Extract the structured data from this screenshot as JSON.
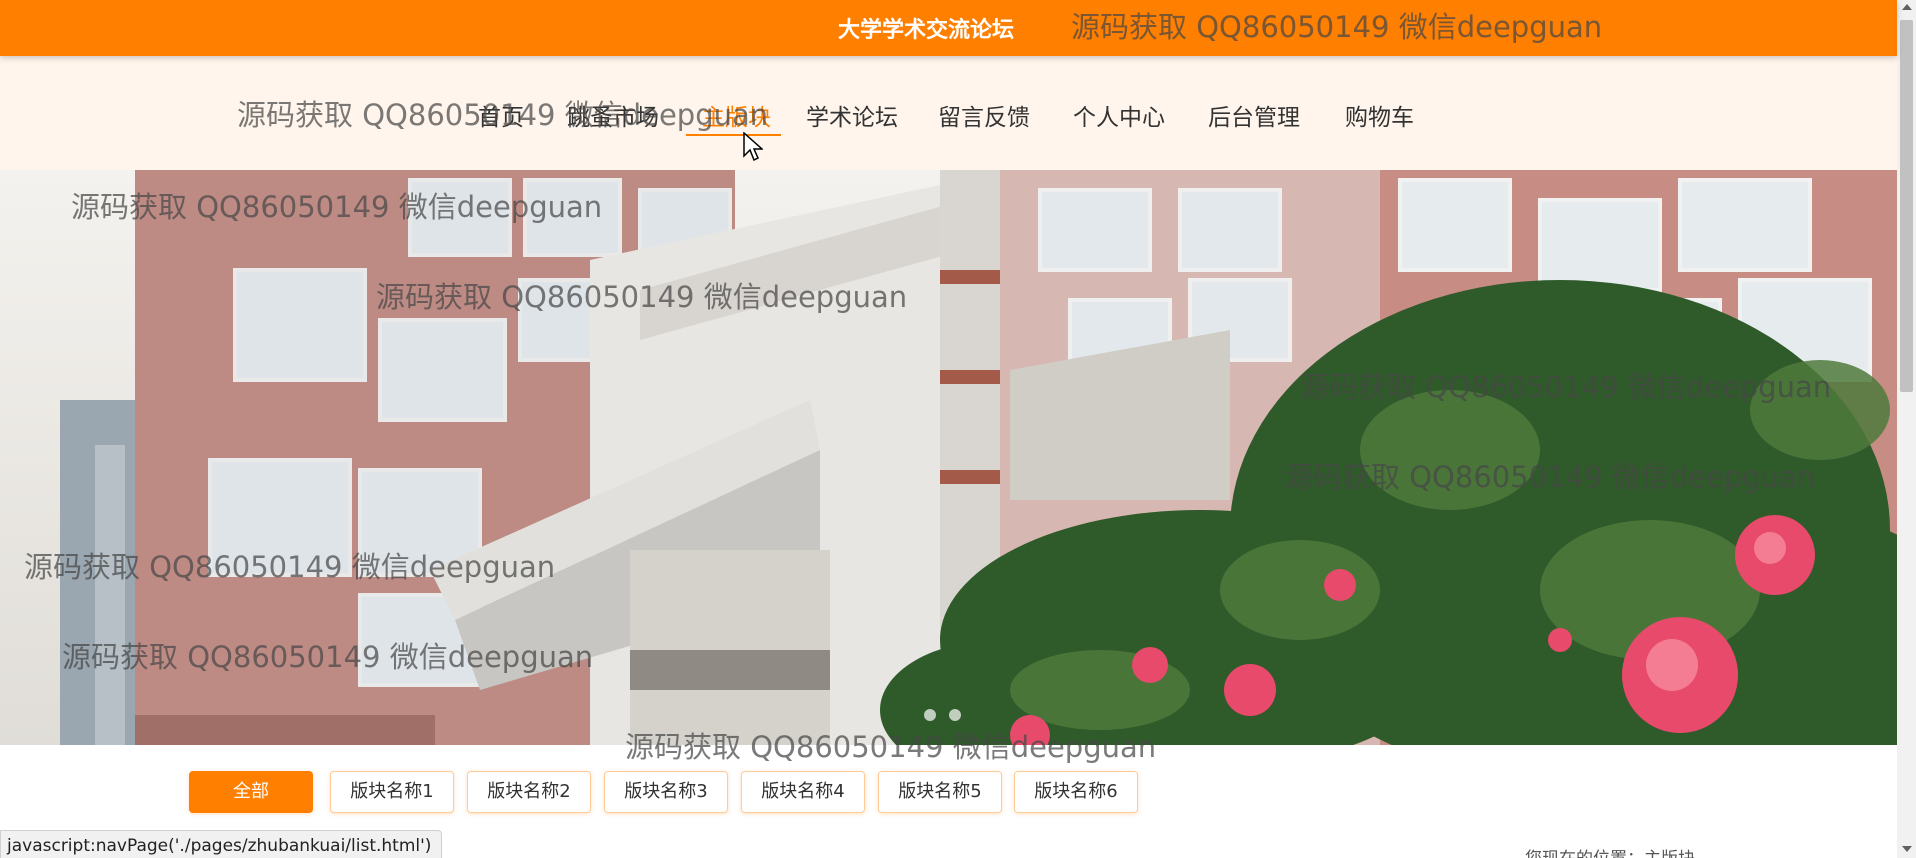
{
  "site": {
    "title": "大学学术交流论坛"
  },
  "watermark": "源码获取 QQ86050149 微信deepguan",
  "nav": {
    "items": [
      {
        "label": "首页"
      },
      {
        "label": "跳蚤市场"
      },
      {
        "label": "主版块"
      },
      {
        "label": "学术论坛"
      },
      {
        "label": "留言反馈"
      },
      {
        "label": "个人中心"
      },
      {
        "label": "后台管理"
      },
      {
        "label": "购物车"
      }
    ],
    "active_index": 2
  },
  "tabs": {
    "items": [
      {
        "label": "全部"
      },
      {
        "label": "版块名称1"
      },
      {
        "label": "版块名称2"
      },
      {
        "label": "版块名称3"
      },
      {
        "label": "版块名称4"
      },
      {
        "label": "版块名称5"
      },
      {
        "label": "版块名称6"
      }
    ],
    "active_index": 0
  },
  "status": {
    "url": "javascript:navPage('./pages/zhubankuai/list.html')"
  },
  "location": {
    "text": "您现在的位置：主版块"
  },
  "colors": {
    "accent": "#ff7f00",
    "nav_bg": "#fff5ec"
  },
  "icons": {
    "cursor": "mouse-pointer-icon"
  }
}
